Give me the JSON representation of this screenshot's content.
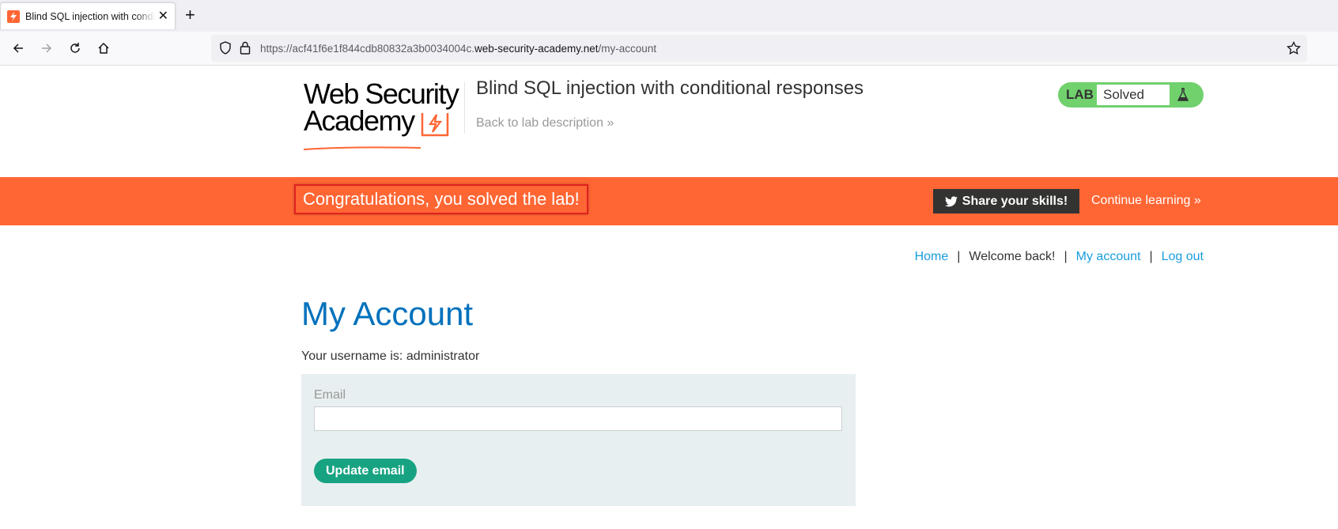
{
  "browser": {
    "tab_title": "Blind SQL injection with conditional responses",
    "new_tab": "+",
    "url": {
      "prefix": "https://acf41f6e1f844cdb80832a3b0034004c.",
      "host": "web-security-academy.net",
      "path": "/my-account"
    }
  },
  "header": {
    "logo_line1": "Web Security",
    "logo_line2": "Academy",
    "lab_title": "Blind SQL injection with conditional responses",
    "back_link": "Back to lab description",
    "lab_status_label": "LAB",
    "lab_status_value": "Solved"
  },
  "banner": {
    "message": "Congratulations, you solved the lab!",
    "share_label": "Share your skills!",
    "continue_label": "Continue learning"
  },
  "nav": {
    "home": "Home",
    "welcome": "Welcome back!",
    "my_account": "My account",
    "log_out": "Log out",
    "separator": "|"
  },
  "main": {
    "heading": "My Account",
    "username_text": "Your username is: administrator",
    "email_label": "Email",
    "email_value": "",
    "update_button": "Update email"
  },
  "colors": {
    "accent_orange": "#ff6633",
    "lab_green": "#70d16d",
    "heading_blue": "#0071bc",
    "link_blue": "#1a9ddd",
    "button_green": "#17a382"
  }
}
